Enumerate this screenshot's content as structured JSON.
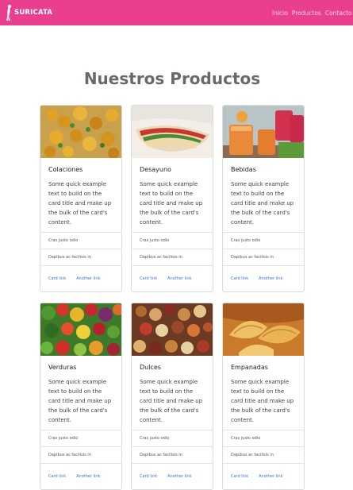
{
  "navbar": {
    "brand": "SURICATA",
    "links": [
      "Inicio",
      "Productos",
      "Contacto"
    ]
  },
  "page_title": "Nuestros Productos",
  "cards": [
    {
      "title": "Colaciones",
      "text": "Some quick example text to build on the card title and make up the bulk of the card's content.",
      "list": [
        "Cras justo odio",
        "Dapibus ac facilisis in"
      ],
      "links": [
        "Card link",
        "Another link"
      ]
    },
    {
      "title": "Desayuno",
      "text": "Some quick example text to build on the card title and make up the bulk of the card's content.",
      "list": [
        "Cras justo odio",
        "Dapibus ac facilisis in"
      ],
      "links": [
        "Card link",
        "Another link"
      ]
    },
    {
      "title": "Bebidas",
      "text": "Some quick example text to build on the card title and make up the bulk of the card's content.",
      "list": [
        "Cras justo odio",
        "Dapibus ac facilisis in"
      ],
      "links": [
        "Card link",
        "Another link"
      ]
    },
    {
      "title": "Verduras",
      "text": "Some quick example text to build on the card title and make up the bulk of the card's content.",
      "list": [
        "Cras justo odio",
        "Dapibus ac facilisis in"
      ],
      "links": [
        "Card link",
        "Another link"
      ]
    },
    {
      "title": "Dulces",
      "text": "Some quick example text to build on the card title and make up the bulk of the card's content.",
      "list": [
        "Cras justo odio",
        "Dapibus ac facilisis in"
      ],
      "links": [
        "Card link",
        "Another link"
      ]
    },
    {
      "title": "Empanadas",
      "text": "Some quick example text to build on the card title and make up the bulk of the card's content.",
      "list": [
        "Cras justo odio",
        "Dapibus ac facilisis in"
      ],
      "links": [
        "Card link",
        "Another link"
      ]
    }
  ],
  "colors": {
    "navbar": "#ea3f8f",
    "title": "#666a6d",
    "link": "#3a72d8"
  }
}
